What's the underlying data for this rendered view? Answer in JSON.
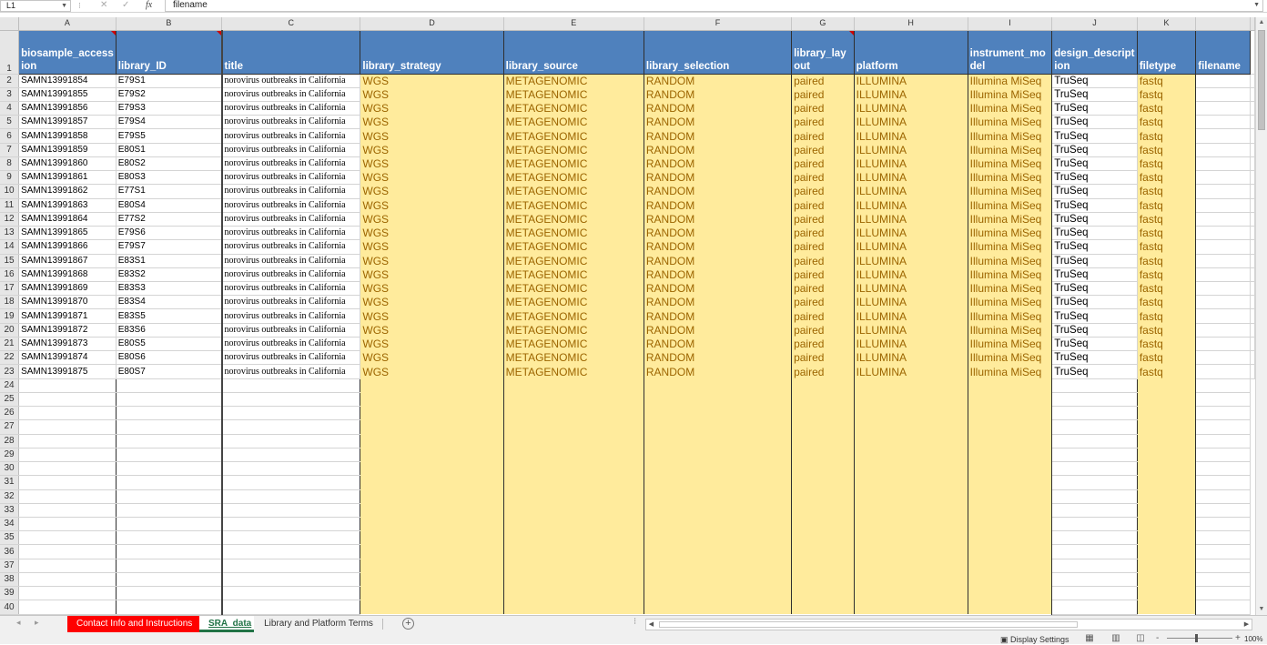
{
  "formula_bar": {
    "name_box": "L1",
    "separator": "⁝",
    "cancel_icon": "✕",
    "enter_icon": "✓",
    "fx_label": "fx",
    "formula": "filename"
  },
  "columns": [
    "A",
    "B",
    "C",
    "D",
    "E",
    "F",
    "G",
    "H",
    "I",
    "J",
    "K",
    ""
  ],
  "header_row": {
    "row_number": "1",
    "cells": [
      "biosample_accession",
      "library_ID",
      "title",
      "library_strategy",
      "library_source",
      "library_selection",
      "library_layout",
      "platform",
      "instrument_model",
      "design_description",
      "filetype",
      "filename"
    ]
  },
  "rows": [
    {
      "n": "2",
      "acc": "SAMN13991854",
      "lib": "E79S1",
      "title": "norovirus outbreaks in California",
      "strategy": "WGS",
      "source": "METAGENOMIC",
      "selection": "RANDOM",
      "layout": "paired",
      "platform": "ILLUMINA",
      "model": "Illumina MiSeq",
      "design": "TruSeq",
      "filetype": "fastq"
    },
    {
      "n": "3",
      "acc": "SAMN13991855",
      "lib": "E79S2",
      "title": "norovirus outbreaks in California",
      "strategy": "WGS",
      "source": "METAGENOMIC",
      "selection": "RANDOM",
      "layout": "paired",
      "platform": "ILLUMINA",
      "model": "Illumina MiSeq",
      "design": "TruSeq",
      "filetype": "fastq"
    },
    {
      "n": "4",
      "acc": "SAMN13991856",
      "lib": "E79S3",
      "title": "norovirus outbreaks in California",
      "strategy": "WGS",
      "source": "METAGENOMIC",
      "selection": "RANDOM",
      "layout": "paired",
      "platform": "ILLUMINA",
      "model": "Illumina MiSeq",
      "design": "TruSeq",
      "filetype": "fastq"
    },
    {
      "n": "5",
      "acc": "SAMN13991857",
      "lib": "E79S4",
      "title": "norovirus outbreaks in California",
      "strategy": "WGS",
      "source": "METAGENOMIC",
      "selection": "RANDOM",
      "layout": "paired",
      "platform": "ILLUMINA",
      "model": "Illumina MiSeq",
      "design": "TruSeq",
      "filetype": "fastq"
    },
    {
      "n": "6",
      "acc": "SAMN13991858",
      "lib": "E79S5",
      "title": "norovirus outbreaks in California",
      "strategy": "WGS",
      "source": "METAGENOMIC",
      "selection": "RANDOM",
      "layout": "paired",
      "platform": "ILLUMINA",
      "model": "Illumina MiSeq",
      "design": "TruSeq",
      "filetype": "fastq"
    },
    {
      "n": "7",
      "acc": "SAMN13991859",
      "lib": "E80S1",
      "title": "norovirus outbreaks in California",
      "strategy": "WGS",
      "source": "METAGENOMIC",
      "selection": "RANDOM",
      "layout": "paired",
      "platform": "ILLUMINA",
      "model": "Illumina MiSeq",
      "design": "TruSeq",
      "filetype": "fastq"
    },
    {
      "n": "8",
      "acc": "SAMN13991860",
      "lib": "E80S2",
      "title": "norovirus outbreaks in California",
      "strategy": "WGS",
      "source": "METAGENOMIC",
      "selection": "RANDOM",
      "layout": "paired",
      "platform": "ILLUMINA",
      "model": "Illumina MiSeq",
      "design": "TruSeq",
      "filetype": "fastq"
    },
    {
      "n": "9",
      "acc": "SAMN13991861",
      "lib": "E80S3",
      "title": "norovirus outbreaks in California",
      "strategy": "WGS",
      "source": "METAGENOMIC",
      "selection": "RANDOM",
      "layout": "paired",
      "platform": "ILLUMINA",
      "model": "Illumina MiSeq",
      "design": "TruSeq",
      "filetype": "fastq"
    },
    {
      "n": "10",
      "acc": "SAMN13991862",
      "lib": "E77S1",
      "title": "norovirus outbreaks in California",
      "strategy": "WGS",
      "source": "METAGENOMIC",
      "selection": "RANDOM",
      "layout": "paired",
      "platform": "ILLUMINA",
      "model": "Illumina MiSeq",
      "design": "TruSeq",
      "filetype": "fastq"
    },
    {
      "n": "11",
      "acc": "SAMN13991863",
      "lib": "E80S4",
      "title": "norovirus outbreaks in California",
      "strategy": "WGS",
      "source": "METAGENOMIC",
      "selection": "RANDOM",
      "layout": "paired",
      "platform": "ILLUMINA",
      "model": "Illumina MiSeq",
      "design": "TruSeq",
      "filetype": "fastq"
    },
    {
      "n": "12",
      "acc": "SAMN13991864",
      "lib": "E77S2",
      "title": "norovirus outbreaks in California",
      "strategy": "WGS",
      "source": "METAGENOMIC",
      "selection": "RANDOM",
      "layout": "paired",
      "platform": "ILLUMINA",
      "model": "Illumina MiSeq",
      "design": "TruSeq",
      "filetype": "fastq"
    },
    {
      "n": "13",
      "acc": "SAMN13991865",
      "lib": "E79S6",
      "title": "norovirus outbreaks in California",
      "strategy": "WGS",
      "source": "METAGENOMIC",
      "selection": "RANDOM",
      "layout": "paired",
      "platform": "ILLUMINA",
      "model": "Illumina MiSeq",
      "design": "TruSeq",
      "filetype": "fastq"
    },
    {
      "n": "14",
      "acc": "SAMN13991866",
      "lib": "E79S7",
      "title": "norovirus outbreaks in California",
      "strategy": "WGS",
      "source": "METAGENOMIC",
      "selection": "RANDOM",
      "layout": "paired",
      "platform": "ILLUMINA",
      "model": "Illumina MiSeq",
      "design": "TruSeq",
      "filetype": "fastq"
    },
    {
      "n": "15",
      "acc": "SAMN13991867",
      "lib": "E83S1",
      "title": "norovirus outbreaks in California",
      "strategy": "WGS",
      "source": "METAGENOMIC",
      "selection": "RANDOM",
      "layout": "paired",
      "platform": "ILLUMINA",
      "model": "Illumina MiSeq",
      "design": "TruSeq",
      "filetype": "fastq"
    },
    {
      "n": "16",
      "acc": "SAMN13991868",
      "lib": "E83S2",
      "title": "norovirus outbreaks in California",
      "strategy": "WGS",
      "source": "METAGENOMIC",
      "selection": "RANDOM",
      "layout": "paired",
      "platform": "ILLUMINA",
      "model": "Illumina MiSeq",
      "design": "TruSeq",
      "filetype": "fastq"
    },
    {
      "n": "17",
      "acc": "SAMN13991869",
      "lib": "E83S3",
      "title": "norovirus outbreaks in California",
      "strategy": "WGS",
      "source": "METAGENOMIC",
      "selection": "RANDOM",
      "layout": "paired",
      "platform": "ILLUMINA",
      "model": "Illumina MiSeq",
      "design": "TruSeq",
      "filetype": "fastq"
    },
    {
      "n": "18",
      "acc": "SAMN13991870",
      "lib": "E83S4",
      "title": "norovirus outbreaks in California",
      "strategy": "WGS",
      "source": "METAGENOMIC",
      "selection": "RANDOM",
      "layout": "paired",
      "platform": "ILLUMINA",
      "model": "Illumina MiSeq",
      "design": "TruSeq",
      "filetype": "fastq"
    },
    {
      "n": "19",
      "acc": "SAMN13991871",
      "lib": "E83S5",
      "title": "norovirus outbreaks in California",
      "strategy": "WGS",
      "source": "METAGENOMIC",
      "selection": "RANDOM",
      "layout": "paired",
      "platform": "ILLUMINA",
      "model": "Illumina MiSeq",
      "design": "TruSeq",
      "filetype": "fastq"
    },
    {
      "n": "20",
      "acc": "SAMN13991872",
      "lib": "E83S6",
      "title": "norovirus outbreaks in California",
      "strategy": "WGS",
      "source": "METAGENOMIC",
      "selection": "RANDOM",
      "layout": "paired",
      "platform": "ILLUMINA",
      "model": "Illumina MiSeq",
      "design": "TruSeq",
      "filetype": "fastq"
    },
    {
      "n": "21",
      "acc": "SAMN13991873",
      "lib": "E80S5",
      "title": "norovirus outbreaks in California",
      "strategy": "WGS",
      "source": "METAGENOMIC",
      "selection": "RANDOM",
      "layout": "paired",
      "platform": "ILLUMINA",
      "model": "Illumina MiSeq",
      "design": "TruSeq",
      "filetype": "fastq"
    },
    {
      "n": "22",
      "acc": "SAMN13991874",
      "lib": "E80S6",
      "title": "norovirus outbreaks in California",
      "strategy": "WGS",
      "source": "METAGENOMIC",
      "selection": "RANDOM",
      "layout": "paired",
      "platform": "ILLUMINA",
      "model": "Illumina MiSeq",
      "design": "TruSeq",
      "filetype": "fastq"
    },
    {
      "n": "23",
      "acc": "SAMN13991875",
      "lib": "E80S7",
      "title": "norovirus outbreaks in California",
      "strategy": "WGS",
      "source": "METAGENOMIC",
      "selection": "RANDOM",
      "layout": "paired",
      "platform": "ILLUMINA",
      "model": "Illumina MiSeq",
      "design": "TruSeq",
      "filetype": "fastq"
    }
  ],
  "empty_rows": [
    "24",
    "25",
    "26",
    "27",
    "28",
    "29",
    "30",
    "31",
    "32",
    "33",
    "34",
    "35",
    "36",
    "37",
    "38",
    "39",
    "40"
  ],
  "tabs": [
    {
      "label": "Contact Info and Instructions"
    },
    {
      "label": "SRA_data",
      "active": true
    },
    {
      "label": "Library and Platform Terms"
    }
  ],
  "add_sheet_icon": "+",
  "status": {
    "display_settings": "Display Settings",
    "zoom_minus": "-",
    "zoom_plus": "+",
    "zoom_level": "100%"
  },
  "colors": {
    "header_blue": "#4f81bd",
    "neutral_fill": "#ffeb9c",
    "neutral_text": "#9c6500",
    "tab_red": "#ff0000",
    "excel_green": "#217346"
  }
}
